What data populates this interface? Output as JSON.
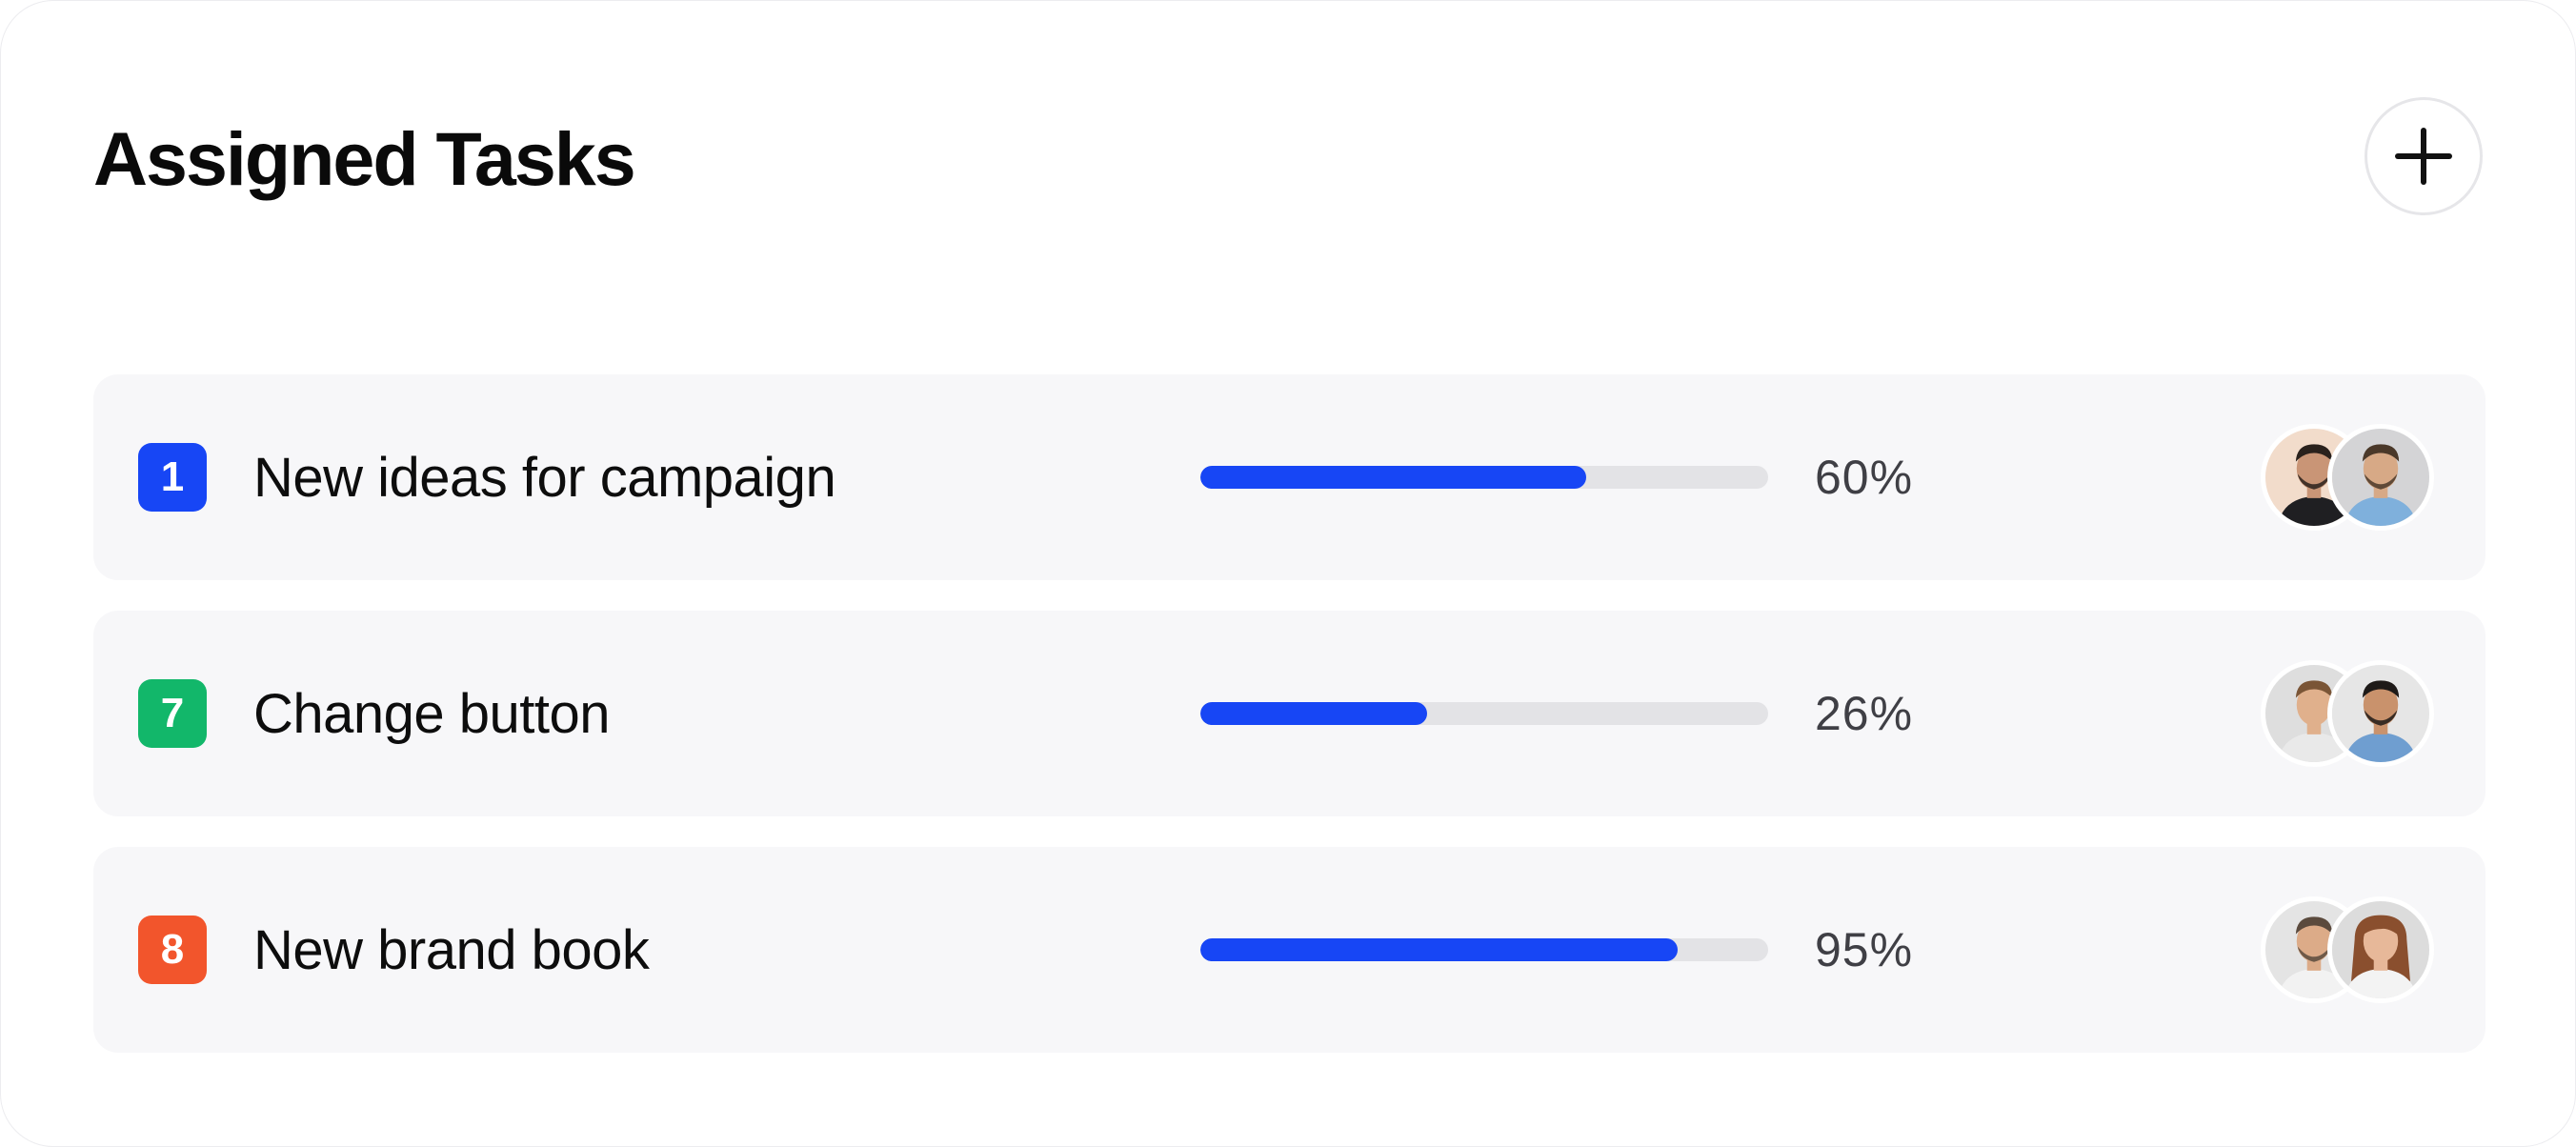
{
  "header": {
    "title": "Assigned Tasks",
    "add_icon": "plus-icon"
  },
  "colors": {
    "progress_fill": "#1746f5",
    "progress_track": "#e3e3e6",
    "row_background": "#f7f7f9"
  },
  "tasks": [
    {
      "number": "1",
      "badge_color": "#1746f5",
      "name": "New ideas for campaign",
      "progress": 0.68,
      "percent_label": "60%",
      "assignees": [
        {
          "icon": "man-avatar",
          "bg": "#f2dccb",
          "skin": "#c99576",
          "hair": "#2a211c",
          "shirt": "#1f1f22",
          "beard": true
        },
        {
          "icon": "man-avatar",
          "bg": "#d4d4d6",
          "skin": "#d7a986",
          "hair": "#4a3829",
          "shirt": "#7fb0dc",
          "beard": true
        }
      ]
    },
    {
      "number": "7",
      "badge_color": "#12b76a",
      "name": "Change button",
      "progress": 0.4,
      "percent_label": "26%",
      "assignees": [
        {
          "icon": "man-avatar",
          "bg": "#dedede",
          "skin": "#e0b08c",
          "hair": "#7a5536",
          "shirt": "#e9e9e9",
          "beard": false
        },
        {
          "icon": "man-avatar",
          "bg": "#e6e6e6",
          "skin": "#c9926c",
          "hair": "#1e1a18",
          "shirt": "#6f9ed0",
          "beard": true
        }
      ]
    },
    {
      "number": "8",
      "badge_color": "#f2552c",
      "name": "New brand book",
      "progress": 0.84,
      "percent_label": "95%",
      "assignees": [
        {
          "icon": "man-avatar",
          "bg": "#e4e4e4",
          "skin": "#dcab88",
          "hair": "#5b4a3d",
          "shirt": "#f2f2f2",
          "beard": true
        },
        {
          "icon": "woman-avatar",
          "bg": "#dcdcdc",
          "skin": "#e7b899",
          "hair": "#8a4f2e",
          "shirt": "#f3f3f3",
          "beard": false
        }
      ]
    }
  ]
}
